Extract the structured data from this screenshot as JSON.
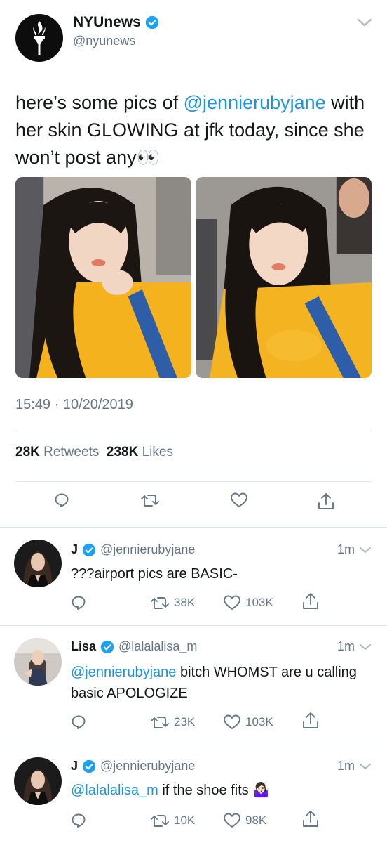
{
  "main_tweet": {
    "author_name": "NYUnews",
    "author_handle": "@nyunews",
    "text_part1": "here’s some pics of ",
    "mention": "@jennierubyjane",
    "text_part2": " with her skin GLOWING at jfk today, since she won’t post any",
    "emoji": "👀",
    "timestamp": "15:49 · 10/20/2019",
    "retweets_count": "28K",
    "retweets_label": "Retweets",
    "likes_count": "238K",
    "likes_label": "Likes"
  },
  "replies": [
    {
      "name": "J",
      "handle": "@jennierubyjane",
      "time": "1m",
      "mention": "",
      "text": "???airport pics are BASIC-",
      "retweets": "38K",
      "likes": "103K"
    },
    {
      "name": "Lisa",
      "handle": "@lalalalisa_m",
      "time": "1m",
      "mention": "@jennierubyjane",
      "text": " bitch WHOMST are u calling basic APOLOGIZE",
      "retweets": "23K",
      "likes": "103K"
    },
    {
      "name": "J",
      "handle": "@jennierubyjane",
      "time": "1m",
      "mention": "@lalalalisa_m",
      "text": " if the shoe fits 🤷🏻‍♀️",
      "retweets": "10K",
      "likes": "98K"
    }
  ],
  "colors": {
    "link": "#1b95e0",
    "secondary_text": "#657786",
    "verified": "#1da1f2"
  }
}
